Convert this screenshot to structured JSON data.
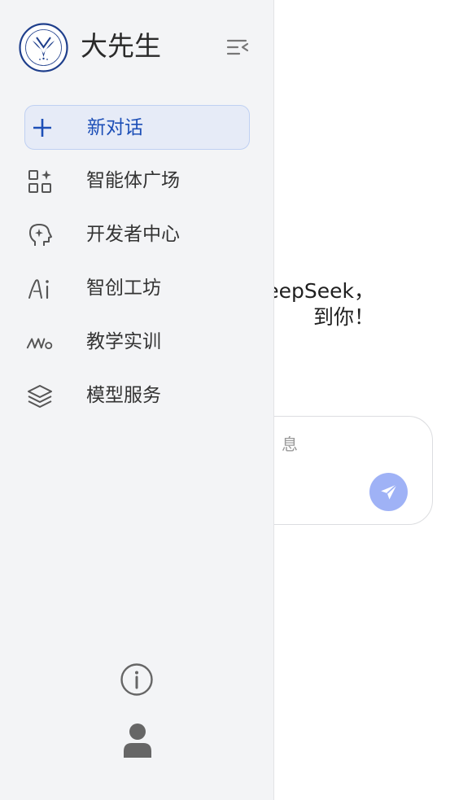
{
  "app": {
    "brand": "大先生",
    "logo_icon": "zju-emblem-logo"
  },
  "sidebar": {
    "new_chat": {
      "label": "新对话",
      "icon": "plus-icon"
    },
    "items": [
      {
        "label": "智能体广场",
        "icon": "apps-grid-icon"
      },
      {
        "label": "开发者中心",
        "icon": "brain-head-icon"
      },
      {
        "label": "智创工坊",
        "icon": "ai-text-icon"
      },
      {
        "label": "教学实训",
        "icon": "mo-logo-icon"
      },
      {
        "label": "模型服务",
        "icon": "layers-icon"
      }
    ],
    "bottom": {
      "info_icon": "info-icon",
      "user_icon": "user-icon"
    }
  },
  "main": {
    "welcome_line1": "是DeepSeek，",
    "welcome_line2": "到你！",
    "composer": {
      "placeholder": "息",
      "send_icon": "send-icon"
    }
  },
  "colors": {
    "accent": "#1d4fb7",
    "sidebar_bg": "#f3f4f6",
    "new_chat_bg": "#e6ebf7",
    "send_bg": "#9fb2f6"
  }
}
